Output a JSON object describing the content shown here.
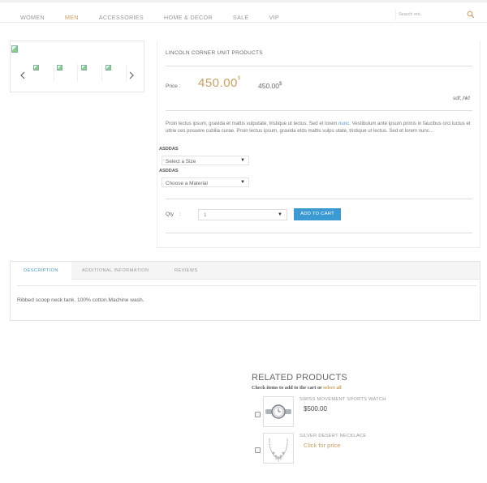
{
  "nav": {
    "items": [
      {
        "label": "WOMEN"
      },
      {
        "label": "MEN"
      },
      {
        "label": "ACCESSORIES"
      },
      {
        "label": "HOME & DECOR"
      },
      {
        "label": "SALE"
      },
      {
        "label": "VIP"
      }
    ],
    "active_index": 1
  },
  "search": {
    "placeholder": "Search ent.."
  },
  "product": {
    "title": "LINCOLN CORNER UNIT PRODUCTS",
    "price_label": "Price :",
    "price_new": "450.00",
    "price_old": "450.00",
    "currency": "$",
    "sku": "sdf;,hkf",
    "description_parts": [
      "Proin lectus ipsum, gravida et mattis vulputate, tristique ut lectus. Sed et lorem ",
      "nunc",
      ". Vestibulum ante ipsum primis in faucibus orci luctus et ultrie ces posuere cubilia curae. Proin lectus ipsum, gravida etds mattis vulps utate, tristique ut lectus. Sed et lorem nunc..."
    ],
    "options": [
      {
        "label": "ASDDAS",
        "selected": "Select a Size"
      },
      {
        "label": "ASDDAS",
        "selected": "Choose a Material"
      }
    ],
    "qty_label": "Qty",
    "qty_sep": ":",
    "qty_value": "1",
    "add_to_cart": "ADD TO CART"
  },
  "tabs": {
    "items": [
      {
        "label": "DESCRIPTION"
      },
      {
        "label": "ADDITIONAL INFORMATION"
      },
      {
        "label": "REVIEWS"
      }
    ],
    "content": "Ribbed scoop neck tank. 100% cotton.Machine wash."
  },
  "related": {
    "title": "RELATED PRODUCTS",
    "subtitle": "Check items to add to the cart or",
    "select_all": "select all",
    "items": [
      {
        "name": "SWISS MOVEMENT SPORTS WATCH",
        "price": "$500.00"
      },
      {
        "name": "SILVER DESERT NECKLACE",
        "price": "Click for price"
      }
    ]
  },
  "colors": {
    "accent": "#c9a060",
    "button": "#3c9ad3",
    "link": "#4a9ac8"
  }
}
